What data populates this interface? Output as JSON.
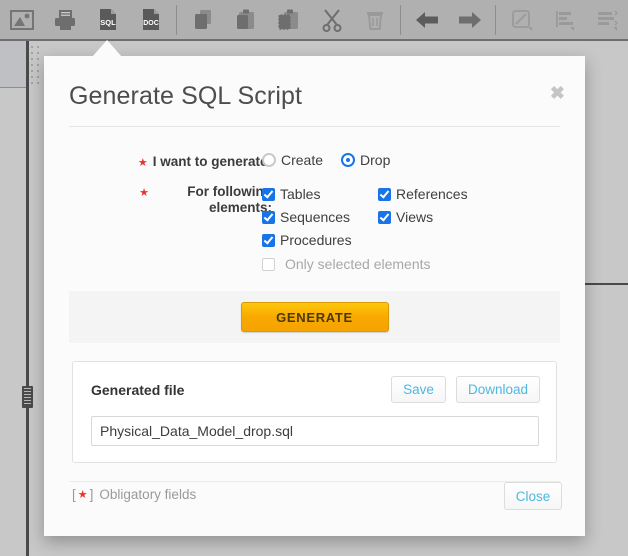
{
  "toolbar": {
    "buttons": [
      {
        "name": "export-image-icon",
        "label": "Export Image"
      },
      {
        "name": "print-icon",
        "label": "Print"
      },
      {
        "name": "generate-sql-icon",
        "label": "SQL"
      },
      {
        "name": "generate-doc-icon",
        "label": "DOC"
      },
      {
        "name": "copy-icon",
        "label": "Copy"
      },
      {
        "name": "paste-icon",
        "label": "Paste"
      },
      {
        "name": "paste-special-icon",
        "label": "Paste Special"
      },
      {
        "name": "cut-icon",
        "label": "Cut"
      },
      {
        "name": "delete-icon",
        "label": "Delete"
      },
      {
        "name": "back-arrow-icon",
        "label": "Back"
      },
      {
        "name": "forward-arrow-icon",
        "label": "Forward"
      },
      {
        "name": "line-style-icon",
        "label": "Line Style"
      },
      {
        "name": "align-left-icon",
        "label": "Align"
      },
      {
        "name": "distribute-icon",
        "label": "Distribute"
      },
      {
        "name": "bring-front-icon",
        "label": "Bring to Front"
      }
    ]
  },
  "dialog": {
    "title": "Generate SQL Script",
    "close_glyph": "✖",
    "fields": {
      "generate_label": "I want to generate:",
      "elements_label_line1": "For following",
      "elements_label_line2": "elements:",
      "required_marker": "★"
    },
    "radios": [
      {
        "label": "Create",
        "checked": false
      },
      {
        "label": "Drop",
        "checked": true
      }
    ],
    "checkboxes": [
      {
        "label": "Tables",
        "checked": true,
        "disabled": false
      },
      {
        "label": "References",
        "checked": true,
        "disabled": false
      },
      {
        "label": "Sequences",
        "checked": true,
        "disabled": false
      },
      {
        "label": "Views",
        "checked": true,
        "disabled": false
      },
      {
        "label": "Procedures",
        "checked": true,
        "disabled": false
      }
    ],
    "only_selected": {
      "label": "Only selected elements",
      "checked": false,
      "disabled": true
    },
    "generate_button": "GENERATE",
    "file_panel": {
      "title": "Generated file",
      "save_label": "Save",
      "download_label": "Download",
      "filename": "Physical_Data_Model_drop.sql",
      "filename_placeholder": "Physical_Data_Model_drop.sql"
    },
    "footer": {
      "obligatory_prefix": "[",
      "obligatory_suffix": "]",
      "obligatory_text": "Obligatory fields",
      "close_label": "Close"
    }
  },
  "colors": {
    "accent_blue": "#1a73e8",
    "button_orange": "#f9a800",
    "link_blue": "#4db8e0",
    "required_red": "#e8352b",
    "toolbar_grey": "#b0b0b0",
    "canvas_grey": "#c8c8c8"
  }
}
